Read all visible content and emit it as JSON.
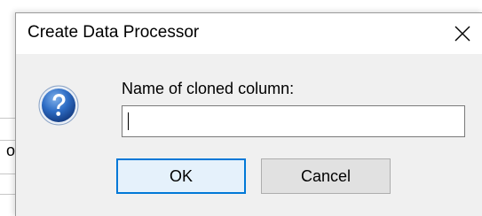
{
  "dialog": {
    "title": "Create Data Processor",
    "prompt": "Name of cloned column:",
    "input": {
      "value": "",
      "placeholder": ""
    },
    "ok_label": "OK",
    "cancel_label": "Cancel",
    "icon": "question-icon",
    "close_icon": "close-icon"
  },
  "background": {
    "partial_char": "o"
  },
  "colors": {
    "focus_border": "#0078d7",
    "dialog_bg": "#f0f0f0",
    "icon_blue": "#2b5ea8"
  }
}
